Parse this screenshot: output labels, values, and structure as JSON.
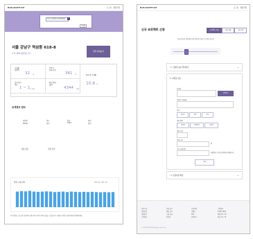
{
  "left": {
    "header": {
      "brand": "BUILDOFFICE",
      "links": "로그인 · 회원가입"
    },
    "search": {
      "placeholder": "주소나 건물명을 입력해주세요",
      "small_link": "도움말"
    },
    "address": "서울 강남구 역삼동 618-8",
    "subtitle": "수익 목록 결과입니다.",
    "cta_button": "건물 상세보기",
    "stats": [
      {
        "label": "공실률",
        "sublabel": "연면적",
        "value": "32",
        "unit": "건"
      },
      {
        "label": "입주사",
        "sublabel": "등록 기업",
        "value": "381",
        "unit": "건"
      },
      {
        "label": "건축 연한",
        "sublabel": "평균",
        "value": "1 ~ 2",
        "unit": "년 이상"
      },
      {
        "label": "평균 임대",
        "sublabel": "월세",
        "value": "4344",
        "unit": "만원"
      },
      {
        "label": "평균 평 수익률",
        "value": "10.6",
        "unit": "%"
      }
    ],
    "info_section_title": "공개정보 정보",
    "info_fields": [
      {
        "label": "연면적",
        "value": "890평"
      },
      {
        "label": "용도",
        "value": "업무"
      },
      {
        "label": "준공",
        "value": "1987"
      },
      {
        "label": "대지",
        "value": "상업"
      }
    ],
    "captions": [
      "대표 정보",
      "건물 이력"
    ],
    "chart_title": "월별 시세 변화",
    "chart_legend": "매매 시세 / 임대 시세",
    "chart_caption": "※ 위 정보는 참고용 자료이며 실제 거래 가격과 차이가 있을 수 있습니다. 자세한 사항은 담당자에게 문의해주세요."
  },
  "right": {
    "header": {
      "brand": "BUILDOFFICE",
      "links": "로그인 · 회원가입"
    },
    "title": "신규 프로젝트 신청",
    "tabs": [
      "프로젝트 신청",
      "진행 현황",
      "신청 내역"
    ],
    "description": "아래 양식을 작성해주시면 담당자가 확인 후 연락드립니다.",
    "step1": "1. 신청자 정보 입력하기",
    "form_heading": "2. 사업장 정보",
    "labels": [
      "상호명",
      "사업자 등록번호",
      "업종",
      "희망 면적",
      "희망 지역",
      "임대 기간",
      "기타 요청사항"
    ],
    "chips_row1": [
      "오피스",
      "상가",
      "창고"
    ],
    "chips_row2": [
      "강남권",
      "여의도권",
      "도심권"
    ],
    "verify_button": "인증하기",
    "unit_pyeong": "평",
    "unit_note": "주소 검색",
    "agree": "개인정보 수집 및 이용에 동의합니다.",
    "submit_button": "다음",
    "step3": "3. 요청사항 확인",
    "footer": {
      "cols": [
        [
          "회사소개",
          "이용약관",
          "개인정보",
          "고객센터"
        ],
        [
          "건물 찾기",
          "매물 등록",
          "시세 조회",
          "컨설팅"
        ],
        [
          "공지사항",
          "이벤트",
          "FAQ",
          "문의하기"
        ],
        [
          "고객센터",
          "1588-0000",
          "평일 09~18",
          "점심 12~13"
        ]
      ],
      "copyright": "© BUILDOFFICE All rights reserved."
    }
  },
  "chart_data": {
    "type": "bar",
    "categories": [
      "1",
      "2",
      "3",
      "4",
      "5",
      "6",
      "7",
      "8",
      "9",
      "10",
      "11",
      "12",
      "13",
      "14",
      "15",
      "16",
      "17",
      "18",
      "19",
      "20",
      "21",
      "22",
      "23",
      "24"
    ],
    "values": [
      66,
      68,
      67,
      69,
      66,
      65,
      66,
      67,
      66,
      64,
      65,
      66,
      64,
      66,
      65,
      64,
      65,
      64,
      65,
      64,
      63,
      64,
      63,
      64
    ],
    "ylim": [
      0,
      100
    ],
    "color": "#4aa4e2"
  }
}
